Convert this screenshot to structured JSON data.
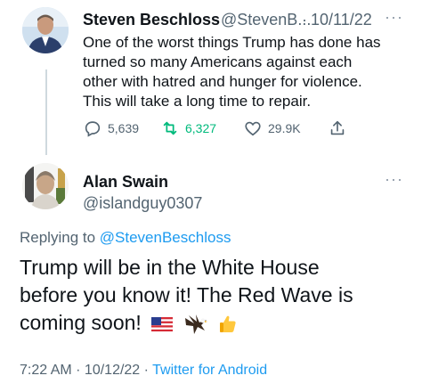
{
  "parent_tweet": {
    "name": "Steven Beschloss",
    "handle": "@StevenB...",
    "separator": "·",
    "date": "10/11/22",
    "more": "···",
    "text_lines": [
      "One of the worst things Trump has done has",
      "turned so many Americans against each",
      "other with hatred and hunger for violence.",
      "This will take a long time to repair."
    ],
    "replies": "5,639",
    "retweets": "6,327",
    "likes": "29.9K",
    "colors": {
      "retweet": "#00ba7c",
      "icon": "#536471"
    }
  },
  "reply_tweet": {
    "name": "Alan Swain",
    "handle": "@islandguy0307",
    "more": "···",
    "replying_label": "Replying to ",
    "replying_to": "@StevenBeschloss",
    "text_lines": [
      "Trump will be in the White House",
      "before you know it! The Red Wave is",
      "coming soon! "
    ],
    "emojis": [
      "us-flag-icon",
      "eagle-icon",
      "thumbs-up-icon"
    ],
    "time": "7:22 AM · 10/12/22 · ",
    "source": "Twitter for Android",
    "colors": {
      "link": "#1d9bf0",
      "muted": "#536471"
    }
  }
}
